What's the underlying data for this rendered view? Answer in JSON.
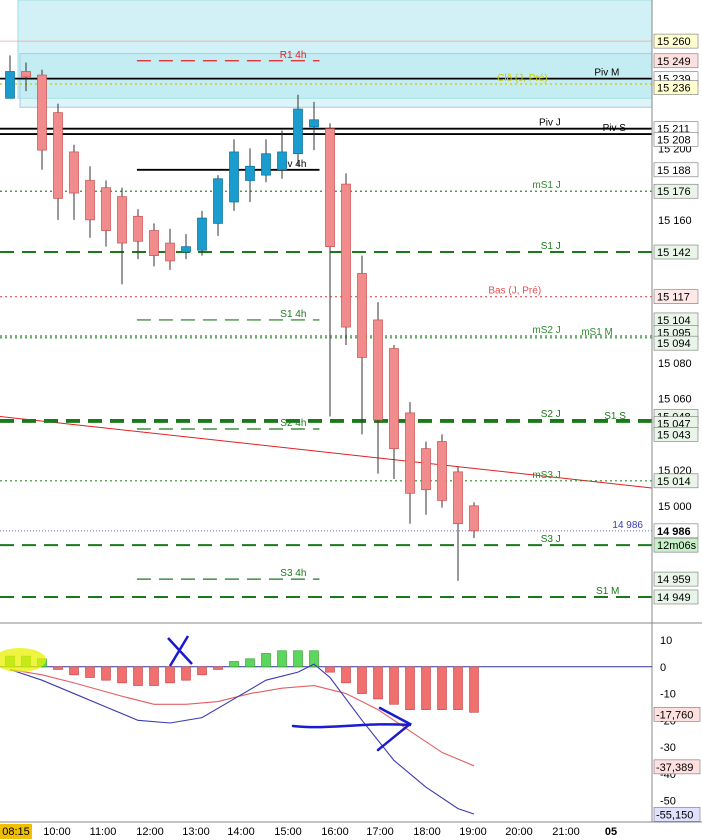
{
  "chart_data": {
    "type": "candlestick",
    "time_axis": {
      "ticks": [
        "08:15",
        "10:00",
        "11:00",
        "12:00",
        "13:00",
        "14:00",
        "15:00",
        "16:00",
        "17:00",
        "18:00",
        "19:00",
        "20:00",
        "21:00",
        "05"
      ],
      "first_tick_highlight": "08:15"
    },
    "price_axis": {
      "range": [
        14935,
        15283
      ],
      "ticks": [
        15200,
        15160,
        15080,
        15060,
        15020,
        15000
      ]
    },
    "zones": [
      {
        "name": "upper-zone",
        "from": 15283,
        "to": 15228,
        "color": "#7fd6e6"
      },
      {
        "name": "upper-zone-inner",
        "from": 15253,
        "to": 15223,
        "color": "#b3e8f0"
      }
    ],
    "levels": [
      {
        "name": "R1 4h",
        "price": 15249,
        "color": "#e02020",
        "style": "dash",
        "x_range": [
          0.21,
          0.49
        ],
        "label_x": 0.47
      },
      {
        "name": "Piv M",
        "price": 15239,
        "color": "#000000",
        "style": "solid",
        "x_range": [
          0.0,
          1.0
        ],
        "label_x": 0.95
      },
      {
        "name": "Clô (J, Pré)",
        "price": 15236,
        "color": "#c8c800",
        "style": "dot",
        "x_range": [
          0.0,
          1.0
        ],
        "label_x": 0.84
      },
      {
        "name": "Piv J",
        "price": 15211,
        "color": "#000000",
        "style": "solid",
        "x_range": [
          0.0,
          1.0
        ],
        "label_x": 0.86
      },
      {
        "name": "Piv S",
        "price": 15208,
        "color": "#000000",
        "style": "solid",
        "x_range": [
          0.0,
          1.0
        ],
        "label_x": 0.96
      },
      {
        "name": "Piv 4h",
        "price": 15188,
        "color": "#000000",
        "style": "solid",
        "x_range": [
          0.21,
          0.49
        ],
        "label_x": 0.47
      },
      {
        "name": "mS1 J",
        "price": 15176,
        "color": "#2e8b2e",
        "style": "dot",
        "x_range": [
          0.0,
          1.0
        ],
        "label_x": 0.86
      },
      {
        "name": "S1 J",
        "price": 15142,
        "color": "#1a7a1a",
        "style": "dash",
        "x_range": [
          0.0,
          1.0
        ],
        "label_x": 0.86
      },
      {
        "name": "Bas (J, Pré)",
        "price": 15117,
        "color": "#e05050",
        "style": "dot",
        "x_range": [
          0.0,
          1.0
        ],
        "label_x": 0.83
      },
      {
        "name": "S1 4h",
        "price": 15104,
        "color": "#1a7a1a",
        "style": "dash",
        "x_range": [
          0.21,
          0.49
        ],
        "label_x": 0.47
      },
      {
        "name": "mS2 J",
        "price": 15095,
        "color": "#2e8b2e",
        "style": "dot",
        "x_range": [
          0.0,
          1.0
        ],
        "label_x": 0.86
      },
      {
        "name": "mS1 M",
        "price": 15094,
        "color": "#2e8b2e",
        "style": "dot",
        "x_range": [
          0.0,
          1.0
        ],
        "label_x": 0.94
      },
      {
        "name": "S2 J",
        "price": 15048,
        "color": "#1a7a1a",
        "style": "dash",
        "x_range": [
          0.0,
          1.0
        ],
        "label_x": 0.86
      },
      {
        "name": "S1 S",
        "price": 15047,
        "color": "#1a7a1a",
        "style": "dash",
        "x_range": [
          0.0,
          1.0
        ],
        "label_x": 0.96
      },
      {
        "name": "S2 4h",
        "price": 15043,
        "color": "#1a7a1a",
        "style": "dash",
        "x_range": [
          0.21,
          0.49
        ],
        "label_x": 0.47
      },
      {
        "name": "mS3 J",
        "price": 15014,
        "color": "#2e8b2e",
        "style": "dot",
        "x_range": [
          0.0,
          1.0
        ],
        "label_x": 0.86
      },
      {
        "name": "S3 J",
        "price": 14978,
        "color": "#1a7a1a",
        "style": "dash",
        "x_range": [
          0.0,
          1.0
        ],
        "label_x": 0.86
      },
      {
        "name": "S3 4h",
        "price": 14959,
        "color": "#1a7a1a",
        "style": "dash",
        "x_range": [
          0.21,
          0.49
        ],
        "label_x": 0.47
      },
      {
        "name": "S1 M",
        "price": 14949,
        "color": "#1a7a1a",
        "style": "dash",
        "x_range": [
          0.0,
          1.0
        ],
        "label_x": 0.95
      }
    ],
    "price_tags": [
      {
        "text": "15 260",
        "price": 15260,
        "bg": "#ffffd0",
        "fg": "#000"
      },
      {
        "text": "15 249",
        "price": 15249,
        "bg": "#ffe0e0",
        "fg": "#c00000"
      },
      {
        "text": "15 239",
        "price": 15239,
        "bg": "#ffffff",
        "fg": "#000"
      },
      {
        "text": "15 236",
        "price": 15234,
        "bg": "#ffffd0",
        "fg": "#a0a000"
      },
      {
        "text": "15 211",
        "price": 15211,
        "bg": "#ffffff",
        "fg": "#000"
      },
      {
        "text": "15 208",
        "price": 15205,
        "bg": "#ffffff",
        "fg": "#000"
      },
      {
        "text": "15 188",
        "price": 15188,
        "bg": "#ffffff",
        "fg": "#000"
      },
      {
        "text": "15 176",
        "price": 15176,
        "bg": "#e8f5e8",
        "fg": "#1a6a1a"
      },
      {
        "text": "15 142",
        "price": 15142,
        "bg": "#e8f5e8",
        "fg": "#1a6a1a"
      },
      {
        "text": "15 117",
        "price": 15117,
        "bg": "#ffe8e8",
        "fg": "#c04040"
      },
      {
        "text": "15 104",
        "price": 15104,
        "bg": "#e8f5e8",
        "fg": "#1a6a1a"
      },
      {
        "text": "15 095",
        "price": 15097,
        "bg": "#e8f5e8",
        "fg": "#1a6a1a"
      },
      {
        "text": "15 094",
        "price": 15091,
        "bg": "#e8f5e8",
        "fg": "#1a6a1a"
      },
      {
        "text": "15 048",
        "price": 15050,
        "bg": "#e8f5e8",
        "fg": "#1a6a1a"
      },
      {
        "text": "15 047",
        "price": 15046,
        "bg": "#e8f5e8",
        "fg": "#1a6a1a"
      },
      {
        "text": "15 043",
        "price": 15040,
        "bg": "#e8f5e8",
        "fg": "#1a6a1a"
      },
      {
        "text": "15 014",
        "price": 15014,
        "bg": "#e8f5e8",
        "fg": "#1a6a1a"
      },
      {
        "text": "14 986",
        "price": 14986,
        "bg": "#ffffff",
        "fg": "#000",
        "bold": true
      },
      {
        "text": "12m06s",
        "price": 14978,
        "bg": "#c8f0c8",
        "fg": "#000"
      },
      {
        "text": "14 959",
        "price": 14959,
        "bg": "#e8f5e8",
        "fg": "#1a6a1a"
      },
      {
        "text": "14 949",
        "price": 14949,
        "bg": "#e8f5e8",
        "fg": "#1a6a1a"
      }
    ],
    "current_price": {
      "label": "14 986",
      "price": 14986,
      "color": "#3a3ab0"
    },
    "trendline": {
      "color": "#e02020",
      "from": {
        "x": 0.0,
        "price": 15050
      },
      "to": {
        "x": 1.0,
        "price": 15010
      }
    },
    "candles": [
      {
        "t": 0.5,
        "o": 15228,
        "h": 15252,
        "l": 15228,
        "c": 15243
      },
      {
        "t": 1.5,
        "o": 15243,
        "h": 15248,
        "l": 15232,
        "c": 15240
      },
      {
        "t": 2.5,
        "o": 15241,
        "h": 15244,
        "l": 15188,
        "c": 15199
      },
      {
        "t": 3.5,
        "o": 15220,
        "h": 15225,
        "l": 15160,
        "c": 15172
      },
      {
        "t": 4.5,
        "o": 15198,
        "h": 15202,
        "l": 15160,
        "c": 15175
      },
      {
        "t": 5.5,
        "o": 15182,
        "h": 15190,
        "l": 15150,
        "c": 15160
      },
      {
        "t": 6.5,
        "o": 15178,
        "h": 15182,
        "l": 15145,
        "c": 15154
      },
      {
        "t": 7.5,
        "o": 15173,
        "h": 15178,
        "l": 15124,
        "c": 15147
      },
      {
        "t": 8.5,
        "o": 15162,
        "h": 15166,
        "l": 15138,
        "c": 15148
      },
      {
        "t": 9.5,
        "o": 15154,
        "h": 15158,
        "l": 15134,
        "c": 15140
      },
      {
        "t": 10.5,
        "o": 15147,
        "h": 15155,
        "l": 15132,
        "c": 15137
      },
      {
        "t": 11.5,
        "o": 15142,
        "h": 15152,
        "l": 15138,
        "c": 15145
      },
      {
        "t": 12.5,
        "o": 15143,
        "h": 15165,
        "l": 15140,
        "c": 15161
      },
      {
        "t": 13.5,
        "o": 15158,
        "h": 15185,
        "l": 15151,
        "c": 15183
      },
      {
        "t": 14.5,
        "o": 15170,
        "h": 15205,
        "l": 15165,
        "c": 15198
      },
      {
        "t": 15.5,
        "o": 15182,
        "h": 15200,
        "l": 15170,
        "c": 15190
      },
      {
        "t": 16.5,
        "o": 15185,
        "h": 15205,
        "l": 15181,
        "c": 15197
      },
      {
        "t": 17.5,
        "o": 15188,
        "h": 15210,
        "l": 15183,
        "c": 15198
      },
      {
        "t": 18.5,
        "o": 15197,
        "h": 15230,
        "l": 15190,
        "c": 15222
      },
      {
        "t": 19.5,
        "o": 15212,
        "h": 15226,
        "l": 15199,
        "c": 15216
      },
      {
        "t": 20.5,
        "o": 15211,
        "h": 15214,
        "l": 15050,
        "c": 15145
      },
      {
        "t": 21.5,
        "o": 15180,
        "h": 15186,
        "l": 15090,
        "c": 15100
      },
      {
        "t": 22.5,
        "o": 15130,
        "h": 15140,
        "l": 15040,
        "c": 15083
      },
      {
        "t": 23.5,
        "o": 15104,
        "h": 15114,
        "l": 15018,
        "c": 15048
      },
      {
        "t": 24.5,
        "o": 15088,
        "h": 15090,
        "l": 15015,
        "c": 15032
      },
      {
        "t": 25.5,
        "o": 15052,
        "h": 15058,
        "l": 14990,
        "c": 15007
      },
      {
        "t": 26.5,
        "o": 15032,
        "h": 15036,
        "l": 14995,
        "c": 15009
      },
      {
        "t": 27.5,
        "o": 15036,
        "h": 15040,
        "l": 14999,
        "c": 15003
      },
      {
        "t": 28.5,
        "o": 15019,
        "h": 15022,
        "l": 14958,
        "c": 14990
      },
      {
        "t": 29.5,
        "o": 15000,
        "h": 15002,
        "l": 14982,
        "c": 14986
      }
    ],
    "indicator": {
      "range": [
        -58,
        16
      ],
      "ticks": [
        10,
        0,
        -10,
        -20,
        -30,
        -40,
        -50
      ],
      "histogram": [
        {
          "t": 0.5,
          "v": 4
        },
        {
          "t": 1.5,
          "v": 4
        },
        {
          "t": 2.5,
          "v": 3
        },
        {
          "t": 3.5,
          "v": -1
        },
        {
          "t": 4.5,
          "v": -3
        },
        {
          "t": 5.5,
          "v": -4
        },
        {
          "t": 6.5,
          "v": -5
        },
        {
          "t": 7.5,
          "v": -6
        },
        {
          "t": 8.5,
          "v": -7
        },
        {
          "t": 9.5,
          "v": -7
        },
        {
          "t": 10.5,
          "v": -6
        },
        {
          "t": 11.5,
          "v": -5
        },
        {
          "t": 12.5,
          "v": -3
        },
        {
          "t": 13.5,
          "v": -1
        },
        {
          "t": 14.5,
          "v": 2
        },
        {
          "t": 15.5,
          "v": 3
        },
        {
          "t": 16.5,
          "v": 5
        },
        {
          "t": 17.5,
          "v": 6
        },
        {
          "t": 18.5,
          "v": 6
        },
        {
          "t": 19.5,
          "v": 6
        },
        {
          "t": 20.5,
          "v": -2
        },
        {
          "t": 21.5,
          "v": -6
        },
        {
          "t": 22.5,
          "v": -10
        },
        {
          "t": 23.5,
          "v": -12
        },
        {
          "t": 24.5,
          "v": -14
        },
        {
          "t": 25.5,
          "v": -16
        },
        {
          "t": 26.5,
          "v": -16
        },
        {
          "t": 27.5,
          "v": -16
        },
        {
          "t": 28.5,
          "v": -16
        },
        {
          "t": 29.5,
          "v": -17
        }
      ],
      "signal_line": {
        "color": "#e06060",
        "points": [
          [
            0.5,
            -1
          ],
          [
            2.5,
            -3
          ],
          [
            4.5,
            -6
          ],
          [
            7.5,
            -11
          ],
          [
            9.5,
            -14
          ],
          [
            11.5,
            -14
          ],
          [
            13.5,
            -13
          ],
          [
            15.5,
            -10
          ],
          [
            17.5,
            -8
          ],
          [
            19.5,
            -7
          ],
          [
            21.5,
            -10
          ],
          [
            23.5,
            -16
          ],
          [
            25.5,
            -24
          ],
          [
            27.5,
            -32
          ],
          [
            29.5,
            -37
          ]
        ]
      },
      "macd_line": {
        "color": "#3a3ab0",
        "points": [
          [
            0.5,
            -1
          ],
          [
            2.5,
            -5
          ],
          [
            4.5,
            -10
          ],
          [
            6.5,
            -15
          ],
          [
            8.5,
            -20
          ],
          [
            10.5,
            -21
          ],
          [
            12.5,
            -19
          ],
          [
            14.5,
            -12
          ],
          [
            16.5,
            -5
          ],
          [
            18.5,
            -2
          ],
          [
            19.5,
            1
          ],
          [
            20.5,
            -4
          ],
          [
            22.5,
            -20
          ],
          [
            24.5,
            -35
          ],
          [
            26.5,
            -45
          ],
          [
            28.5,
            -53
          ],
          [
            29.5,
            -55
          ]
        ]
      },
      "tags": [
        {
          "text": "-17,760",
          "value": -17.76,
          "bg": "#ffe0e0",
          "fg": "#c00000"
        },
        {
          "text": "-37,389",
          "value": -37.39,
          "bg": "#ffe0e0",
          "fg": "#c00000"
        },
        {
          "text": "-55,150",
          "value": -55.15,
          "bg": "#e0e0ff",
          "fg": "#2020a0"
        }
      ],
      "annotations": [
        "X mark on green histogram",
        "yellow highlight",
        "blue arrow"
      ]
    }
  }
}
